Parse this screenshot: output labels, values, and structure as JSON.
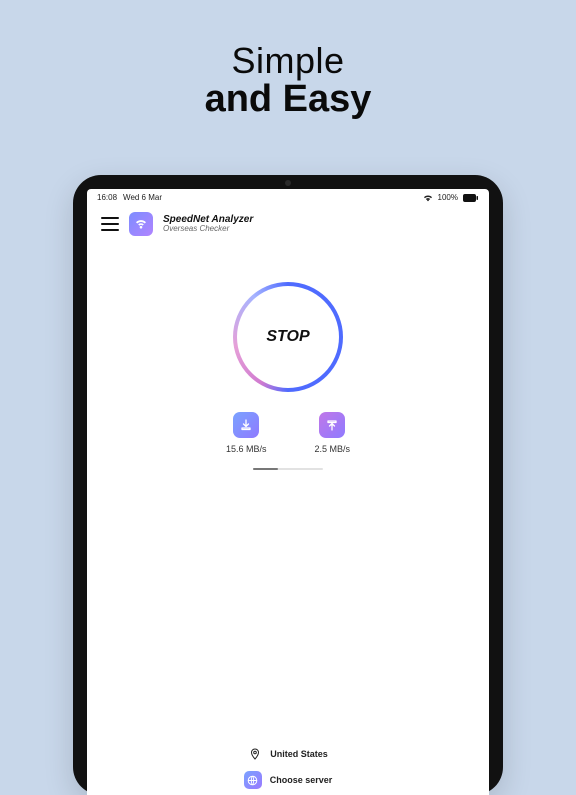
{
  "promo": {
    "line1": "Simple",
    "line2": "and Easy"
  },
  "status_bar": {
    "time": "16:08",
    "date": "Wed 6 Mar",
    "battery": "100%"
  },
  "header": {
    "app_title": "SpeedNet Analyzer",
    "app_subtitle": "Overseas Checker"
  },
  "main": {
    "stop_label": "STOP",
    "download_speed": "15.6 MB/s",
    "upload_speed": "2.5 MB/s"
  },
  "footer": {
    "location": "United States",
    "choose_server": "Choose server"
  }
}
